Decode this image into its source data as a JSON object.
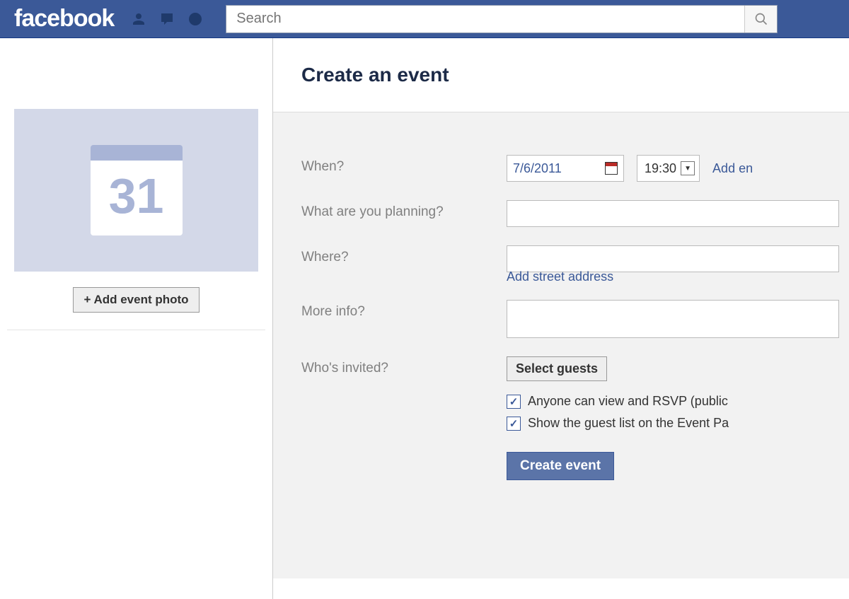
{
  "header": {
    "logo": "facebook",
    "search_placeholder": "Search"
  },
  "sidebar": {
    "calendar_day": "31",
    "add_photo_label": "+ Add event photo"
  },
  "page": {
    "title": "Create an event"
  },
  "form": {
    "labels": {
      "when": "When?",
      "what": "What are you planning?",
      "where": "Where?",
      "more": "More info?",
      "who": "Who's invited?"
    },
    "date_value": "7/6/2011",
    "time_value": "19:30",
    "add_end_link": "Add en",
    "address_link": "Add street address",
    "select_guests_label": "Select guests",
    "chk_public_label": "Anyone can view and RSVP (public",
    "chk_guestlist_label": "Show the guest list on the Event Pa",
    "submit_label": "Create event"
  }
}
